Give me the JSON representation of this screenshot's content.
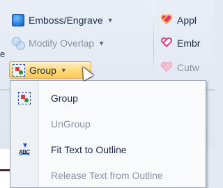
{
  "ribbon": {
    "emboss": {
      "label": "Emboss/Engrave",
      "icon": "emboss-icon"
    },
    "overlap": {
      "label": "Modify Overlap",
      "icon": "overlap-icon"
    },
    "group": {
      "label": "Group",
      "icon": "group-icon"
    },
    "apply": {
      "label": "Appl",
      "icon": "heart-apply-icon"
    },
    "embroider": {
      "label": "Embr",
      "icon": "heart-embroider-icon"
    },
    "cutwork": {
      "label": "Cutw",
      "icon": "heart-cutwork-icon"
    },
    "left_edge_char": "e"
  },
  "menu": {
    "items": [
      {
        "label": "Group",
        "icon": "group-icon",
        "enabled": true
      },
      {
        "label": "UnGroup",
        "icon": "",
        "enabled": false
      },
      {
        "label": "Fit Text to Outline",
        "icon": "fit-text-icon",
        "icon_text": "ABC",
        "enabled": true
      },
      {
        "label": "Release Text from Outline",
        "icon": "",
        "enabled": false
      }
    ]
  },
  "colors": {
    "highlight": "#ffd978",
    "disabled_text": "#8a93a3",
    "accent": "#1c6fd0"
  }
}
